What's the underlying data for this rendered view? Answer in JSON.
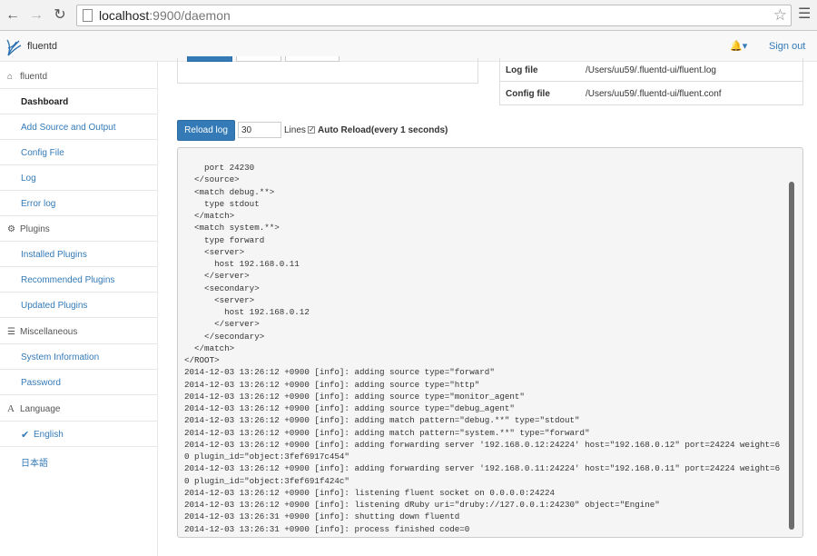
{
  "browser": {
    "url_host": "localhost",
    "url_rest": ":9900/daemon"
  },
  "navbar": {
    "brand": "fluentd",
    "signout": "Sign out"
  },
  "sidebar": {
    "section_fluentd": "fluentd",
    "dashboard": "Dashboard",
    "add_source": "Add Source and Output",
    "config_file": "Config File",
    "log": "Log",
    "error_log": "Error log",
    "section_plugins": "Plugins",
    "installed_plugins": "Installed Plugins",
    "recommended_plugins": "Recommended Plugins",
    "updated_plugins": "Updated Plugins",
    "section_misc": "Miscellaneous",
    "system_information": "System Information",
    "password": "Password",
    "section_language": "Language",
    "english": "English",
    "japanese": "日本語"
  },
  "info": {
    "log_file_label": "Log file",
    "log_file_value": "/Users/uu59/.fluentd-ui/fluent.log",
    "config_file_label": "Config file",
    "config_file_value": "/Users/uu59/.fluentd-ui/fluent.conf"
  },
  "log_controls": {
    "reload_label": "Reload log",
    "lines_value": "30",
    "lines_label": "Lines",
    "auto_reload_label": "Auto Reload(every 1 seconds)",
    "auto_reload_checked": true
  },
  "log_lines": [
    "    port 24230",
    "  </source>",
    "  <match debug.**>",
    "    type stdout",
    "  </match>",
    "  <match system.**>",
    "    type forward",
    "    <server>",
    "      host 192.168.0.11",
    "    </server>",
    "    <secondary>",
    "      <server>",
    "        host 192.168.0.12",
    "      </server>",
    "    </secondary>",
    "  </match>",
    "</ROOT>",
    "2014-12-03 13:26:12 +0900 [info]: adding source type=\"forward\"",
    "2014-12-03 13:26:12 +0900 [info]: adding source type=\"http\"",
    "2014-12-03 13:26:12 +0900 [info]: adding source type=\"monitor_agent\"",
    "2014-12-03 13:26:12 +0900 [info]: adding source type=\"debug_agent\"",
    "2014-12-03 13:26:12 +0900 [info]: adding match pattern=\"debug.**\" type=\"stdout\"",
    "2014-12-03 13:26:12 +0900 [info]: adding match pattern=\"system.**\" type=\"forward\"",
    "2014-12-03 13:26:12 +0900 [info]: adding forwarding server '192.168.0.12:24224' host=\"192.168.0.12\" port=24224 weight=6",
    "0 plugin_id=\"object:3fef6917c454\"",
    "2014-12-03 13:26:12 +0900 [info]: adding forwarding server '192.168.0.11:24224' host=\"192.168.0.11\" port=24224 weight=6",
    "0 plugin_id=\"object:3fef691f424c\"",
    "2014-12-03 13:26:12 +0900 [info]: listening fluent socket on 0.0.0.0:24224",
    "2014-12-03 13:26:12 +0900 [info]: listening dRuby uri=\"druby://127.0.0.1:24230\" object=\"Engine\"",
    "2014-12-03 13:26:31 +0900 [info]: shutting down fluentd",
    "2014-12-03 13:26:31 +0900 [info]: process finished code=0"
  ],
  "colors": {
    "link": "#337ab7",
    "primary_button": "#337ab7",
    "log_background": "#f5f5f5"
  }
}
